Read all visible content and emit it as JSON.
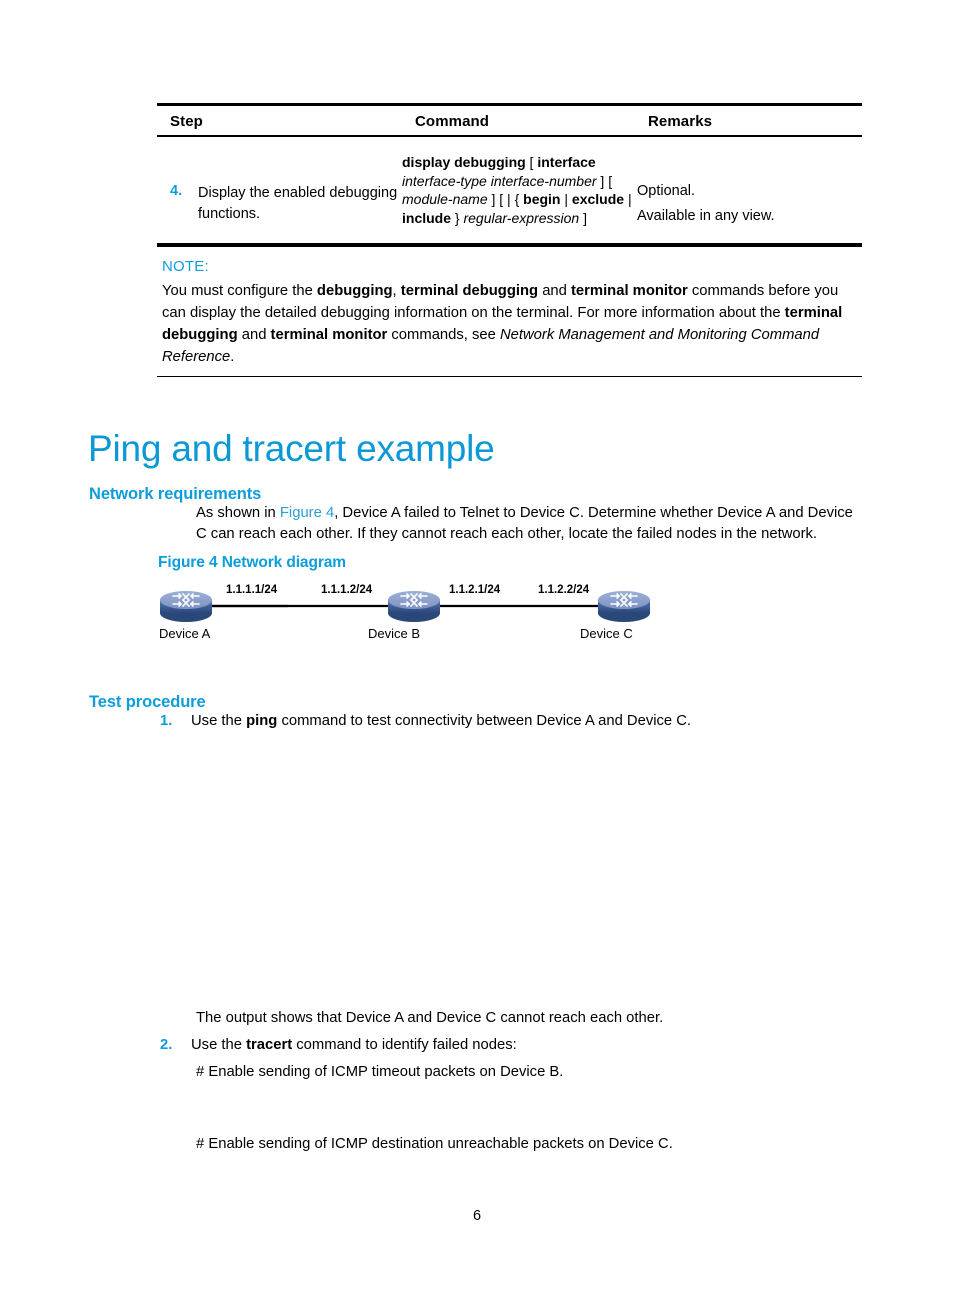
{
  "table": {
    "headers": [
      "Step",
      "Command",
      "Remarks"
    ],
    "rows": [
      {
        "number": "4.",
        "step": "Display the enabled debugging functions.",
        "command_parts": [
          {
            "text": "display debugging",
            "style": "bold"
          },
          {
            "text": " [ ",
            "style": "plain"
          },
          {
            "text": "interface",
            "style": "bold"
          },
          {
            "text": " ",
            "style": "plain"
          },
          {
            "text": "interface-type interface-number",
            "style": "italic"
          },
          {
            "text": " ] [ ",
            "style": "plain"
          },
          {
            "text": "module-name",
            "style": "italic"
          },
          {
            "text": " ] [ | { ",
            "style": "plain"
          },
          {
            "text": "begin",
            "style": "bold"
          },
          {
            "text": " | ",
            "style": "plain"
          },
          {
            "text": "exclude",
            "style": "bold"
          },
          {
            "text": " | ",
            "style": "plain"
          },
          {
            "text": "include",
            "style": "bold"
          },
          {
            "text": " } ",
            "style": "plain"
          },
          {
            "text": "regular-expression",
            "style": "italic"
          },
          {
            "text": " ]",
            "style": "plain"
          }
        ],
        "remarks": [
          "Optional.",
          "Available in any view."
        ]
      }
    ]
  },
  "note": {
    "label": "NOTE:",
    "parts": [
      {
        "text": "You must configure the ",
        "style": "plain"
      },
      {
        "text": "debugging",
        "style": "bold"
      },
      {
        "text": ", ",
        "style": "plain"
      },
      {
        "text": "terminal debugging",
        "style": "bold"
      },
      {
        "text": " and ",
        "style": "plain"
      },
      {
        "text": "terminal monitor",
        "style": "bold"
      },
      {
        "text": " commands before you can display the detailed debugging information on the terminal. For more information about the ",
        "style": "plain"
      },
      {
        "text": "terminal debugging",
        "style": "bold"
      },
      {
        "text": " and ",
        "style": "plain"
      },
      {
        "text": "terminal monitor",
        "style": "bold"
      },
      {
        "text": " commands, see ",
        "style": "plain"
      },
      {
        "text": "Network Management and Monitoring Command Reference",
        "style": "italic"
      },
      {
        "text": ".",
        "style": "plain"
      }
    ]
  },
  "headings": {
    "title": "Ping and tracert example",
    "network_requirements": "Network requirements",
    "test_procedure": "Test procedure"
  },
  "network_requirements": {
    "parts": [
      {
        "text": "As shown in ",
        "style": "plain"
      },
      {
        "text": "Figure 4",
        "style": "link"
      },
      {
        "text": ", Device A failed to Telnet to Device C. Determine whether Device A and Device C can reach each other. If they cannot reach each other, locate the failed nodes in the network.",
        "style": "plain"
      }
    ]
  },
  "figure": {
    "caption": "Figure 4 Network diagram",
    "devices": [
      {
        "name": "Device A"
      },
      {
        "name": "Device B"
      },
      {
        "name": "Device C"
      }
    ],
    "ip_labels": [
      "1.1.1.1/24",
      "1.1.1.2/24",
      "1.1.2.1/24",
      "1.1.2.2/24"
    ],
    "icon": "router-icon",
    "icon_colors": {
      "top": "#8C9FCB",
      "body": "#4A6AA8",
      "side": "#2F4D85",
      "outline": "#1B2E55"
    }
  },
  "test_procedure": {
    "step1": {
      "number": "1.",
      "parts": [
        {
          "text": "Use the ",
          "style": "plain"
        },
        {
          "text": "ping",
          "style": "bold"
        },
        {
          "text": " command to test connectivity between Device A and Device C.",
          "style": "plain"
        }
      ]
    },
    "output1": "The output shows that Device A and Device C cannot reach each other.",
    "step2": {
      "number": "2.",
      "parts": [
        {
          "text": "Use the ",
          "style": "plain"
        },
        {
          "text": "tracert",
          "style": "bold"
        },
        {
          "text": " command to identify failed nodes:",
          "style": "plain"
        }
      ]
    },
    "sub1": "# Enable sending of ICMP timeout packets on Device B.",
    "sub2": "# Enable sending of ICMP destination unreachable packets on Device C."
  },
  "page_number": "6",
  "colors": {
    "heading_blue": "#0B98D7",
    "accent_blue": "#0D9DDB",
    "link_blue": "#2A9FD8",
    "rule_black": "#000000"
  }
}
